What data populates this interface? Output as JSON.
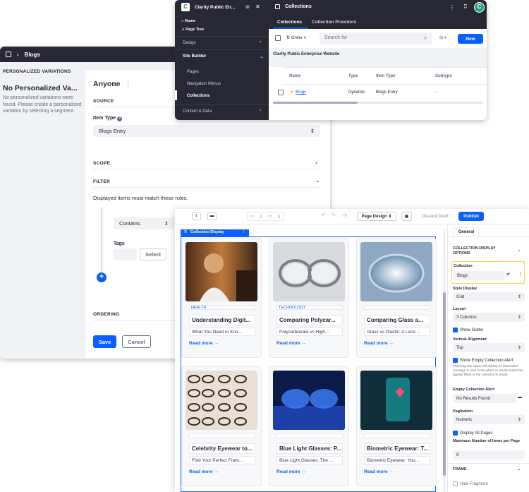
{
  "blogs_window": {
    "header_title": "Blogs",
    "left": {
      "heading": "PERSONALIZED VARIATIONS",
      "title": "No Personalized Va...",
      "text": "No personalized variations were found. Please create a personalized variation by selecting a segment."
    },
    "segment": "Anyone",
    "source_label": "SOURCE",
    "item_type_label": "Item Type",
    "item_type_value": "Blogs Entry",
    "scope_label": "SCOPE",
    "filter_label": "FILTER",
    "filter_text": "Displayed items must match these rules.",
    "contains_value": "Contains",
    "tags_label": "Tags",
    "select_label": "Select",
    "ordering_label": "ORDERING",
    "save_label": "Save",
    "cancel_label": "Cancel"
  },
  "site_builder": {
    "site_name": "Clarity Public En...",
    "nav": {
      "home": "Home",
      "page_tree": "Page Tree",
      "design": "Design",
      "site_builder": "Site Builder",
      "pages": "Pages",
      "navigation_menus": "Navigation Menus",
      "collections": "Collections",
      "content_data": "Content & Data"
    },
    "title": "Collections",
    "tabs": [
      "Collections",
      "Collection Providers"
    ],
    "order_label": "Order",
    "search_placeholder": "Search for",
    "new_label": "New",
    "group_label": "Clarity Public Enterprise Website",
    "columns": [
      "Name",
      "Type",
      "Item Type",
      "Subtype"
    ],
    "row": {
      "name": "Blogs",
      "type": "Dynamic",
      "item_type": "Blogs Entry",
      "subtype": "-"
    }
  },
  "page_editor": {
    "page_design_label": "Page Design",
    "discard_label": "Discard Draft",
    "publish_label": "Publish",
    "collection_display_label": "Collection Display",
    "read_more": "Read more →",
    "cards": [
      {
        "category": "HEALTH",
        "title": "Understanding Digit...",
        "desc": "What You Need to Kno..."
      },
      {
        "category": "TECHNOLOGY",
        "title": "Comparing Polycar...",
        "desc": "Polycarbonate vs High..."
      },
      {
        "category": "",
        "title": "Comparing Glass a...",
        "desc": "Glass vs Plastic: A Lens ..."
      },
      {
        "category": "",
        "title": "Celebrity Eyewear to...",
        "desc": "Find Your Perfect Fram..."
      },
      {
        "category": "",
        "title": "Blue Light Glasses: P...",
        "desc": "Blue Light Glasses: The ..."
      },
      {
        "category": "",
        "title": "Biometric Eyewear: T...",
        "desc": "Biometric Eyewear: You..."
      }
    ],
    "panel": {
      "tab": "General",
      "options_heading": "COLLECTION DISPLAY OPTIONS",
      "collection_label": "Collection",
      "collection_value": "Blogs",
      "style_label": "Style Display",
      "style_value": "Grid",
      "layout_label": "Layout",
      "layout_value": "3 Columns",
      "show_gutter": "Show Gutter",
      "vertical_label": "Vertical Alignment",
      "vertical_value": "Top",
      "show_empty": "Show Empty Collection Alert",
      "show_empty_help": "Checking this option will display an informative message in view mode when no results match the applied filters or the collection is empty.",
      "empty_alert_label": "Empty Collection Alert",
      "empty_alert_value": "No Results Found",
      "pagination_label": "Pagination",
      "pagination_value": "Numeric",
      "display_all": "Display All Pages",
      "max_label": "Maximum Number of Items per Page",
      "max_value": "9",
      "frame_label": "FRAME",
      "hide_fragment": "Hide Fragment"
    }
  },
  "colors": {
    "primary": "#0b5fff",
    "dark": "#272833",
    "highlight": "#ffd23f"
  }
}
